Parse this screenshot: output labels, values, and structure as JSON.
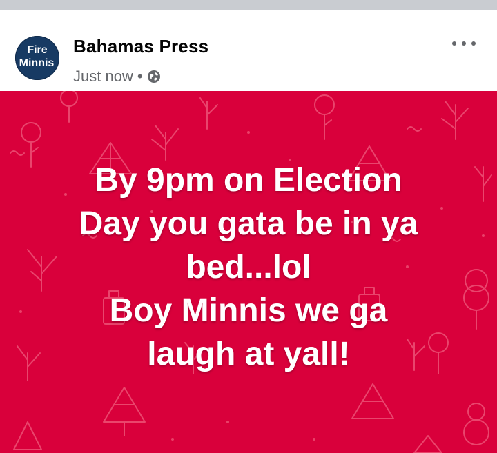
{
  "post": {
    "avatar_text": [
      "Fire",
      "Minnis"
    ],
    "page_name": "Bahamas Press",
    "timestamp": "Just now",
    "separator": "•",
    "privacy_icon": "globe-icon",
    "menu_icon": "more-options-icon",
    "background_color": "#d9003b",
    "text_lines": [
      "By 9pm on Election",
      "Day you gata be in ya",
      "bed...lol",
      "Boy Minnis we ga",
      "laugh at yall!"
    ]
  },
  "colors": {
    "avatar_bg": "#173a63",
    "muted_text": "#65676b",
    "name_text": "#050505",
    "post_text": "#ffffff"
  }
}
